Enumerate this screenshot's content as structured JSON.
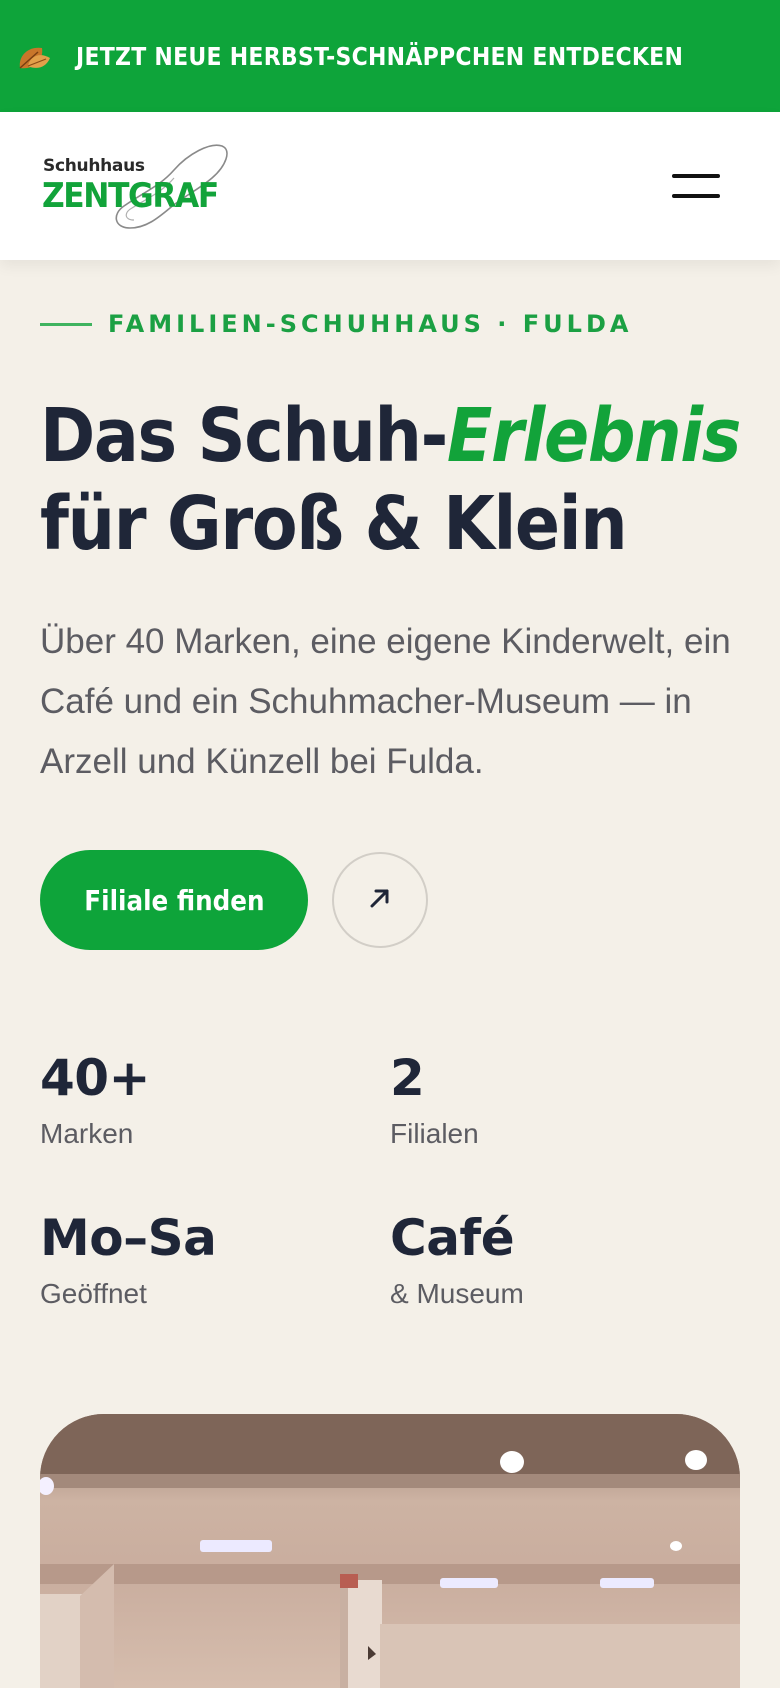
{
  "promo_bar": {
    "text": "JETZT NEUE HERBST-SCHNÄPPCHEN ENTDECKEN",
    "icon": "autumn-leaves-icon",
    "background": "#0ea43a"
  },
  "header": {
    "logo_top": "Schuhhaus",
    "logo_main": "ZENTGRAF",
    "menu_icon": "hamburger-menu-icon"
  },
  "hero": {
    "eyebrow": "FAMILIEN-SCHUHHAUS · FULDA",
    "headline_part1": "Das Schuh-",
    "headline_accent": "Erlebnis",
    "headline_line2": "für Groß & Klein",
    "intro": "Über 40 Marken, eine eigene Kinderwelt, ein Café und ein Schuhmacher-Museum — in Arzell und Künzell bei Fulda.",
    "cta_label": "Filiale finden",
    "arrow_icon": "arrow-up-right-icon"
  },
  "stats": [
    {
      "value": "40+",
      "label": "Marken"
    },
    {
      "value": "2",
      "label": "Filialen"
    },
    {
      "value": "Mo–Sa",
      "label": "Geöffnet"
    },
    {
      "value": "Café",
      "label": "& Museum"
    }
  ],
  "colors": {
    "brand_green": "#0ea43a",
    "navy_text": "#1f2638",
    "page_background": "#f4f0e8"
  }
}
